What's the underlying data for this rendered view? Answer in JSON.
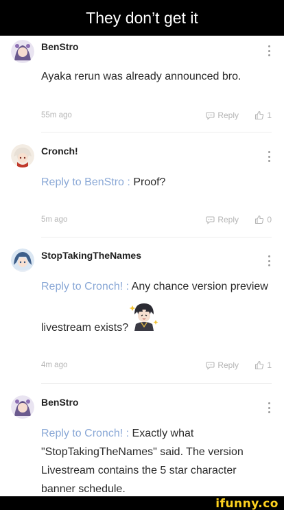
{
  "header": {
    "title": "They don’t get it"
  },
  "comments": [
    {
      "username": "BenStro",
      "text": "Ayaka rerun was already announced bro.",
      "time": "55m ago",
      "reply_label": "Reply",
      "likes": "1"
    },
    {
      "username": "Cronch!",
      "reply_prefix": "Reply to BenStro",
      "separator": ":",
      "text": "Proof?",
      "time": "5m ago",
      "reply_label": "Reply",
      "likes": "0"
    },
    {
      "username": "StopTakingTheNames",
      "reply_prefix": "Reply to Cronch!",
      "separator": ":",
      "text_line1": "Any chance version preview",
      "text_line2": "livestream exists?",
      "time": "4m ago",
      "reply_label": "Reply",
      "likes": "1"
    },
    {
      "username": "BenStro",
      "reply_prefix": "Reply to Cronch!",
      "separator": ":",
      "text_line1": "Exactly what",
      "text_line2": "\"StopTakingTheNames\" said. The version",
      "text_line3": "Livestream contains the 5 star character",
      "text_line4": "banner schedule."
    }
  ],
  "watermark": {
    "text": "ifunny.co"
  },
  "colors": {
    "link": "#8aa8d6",
    "meta": "#b5b5b5",
    "logo": "#ffd21f"
  },
  "icons": [
    "avatar",
    "more-vertical-icon",
    "reply-bubble-icon",
    "thumbs-up-icon",
    "sticker-image"
  ]
}
